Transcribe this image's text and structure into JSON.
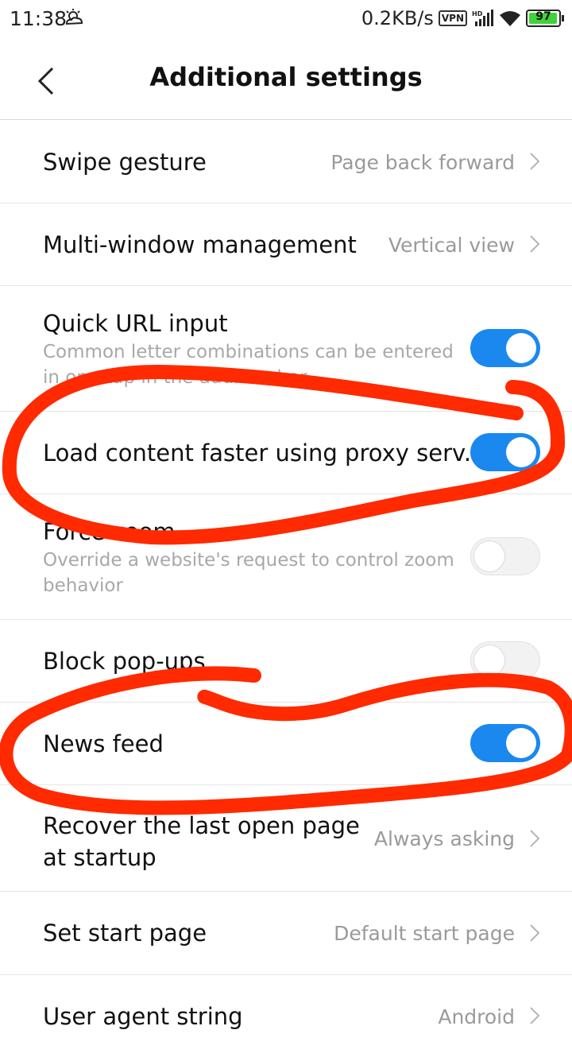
{
  "status_bar": {
    "time": "11:38",
    "net_speed": "0.2KB/s",
    "vpn": "VPN",
    "battery": "97",
    "icons": [
      "weather-icon",
      "vpn-icon",
      "signal-icon",
      "wifi-icon",
      "battery-icon"
    ]
  },
  "header": {
    "title": "Additional settings",
    "back_icon": "chevron-left-icon"
  },
  "settings": [
    {
      "label": "Swipe gesture",
      "value": "Page back forward",
      "type": "nav"
    },
    {
      "label": "Multi-window management",
      "value": "Vertical view",
      "type": "nav"
    },
    {
      "label": "Quick URL input",
      "sub": "Common letter combinations can be entered in one tap in the address bar",
      "type": "toggle",
      "on": true
    },
    {
      "label": "Load content faster using proxy serv..",
      "type": "toggle",
      "on": true
    },
    {
      "label": "Force zoom",
      "sub": "Override a website's request to control zoom behavior",
      "type": "toggle",
      "on": false
    },
    {
      "label": "Block pop-ups",
      "type": "toggle",
      "on": false
    },
    {
      "label": "News feed",
      "type": "toggle",
      "on": true
    },
    {
      "label": "Recover the last open page at startup",
      "value": "Always asking",
      "type": "nav"
    },
    {
      "label": "Set start page",
      "value": "Default start page",
      "type": "nav"
    },
    {
      "label": "User agent string",
      "value": "Android",
      "type": "nav"
    }
  ],
  "colors": {
    "toggle_on": "#1a88ef",
    "annotation": "#ff2a00"
  }
}
